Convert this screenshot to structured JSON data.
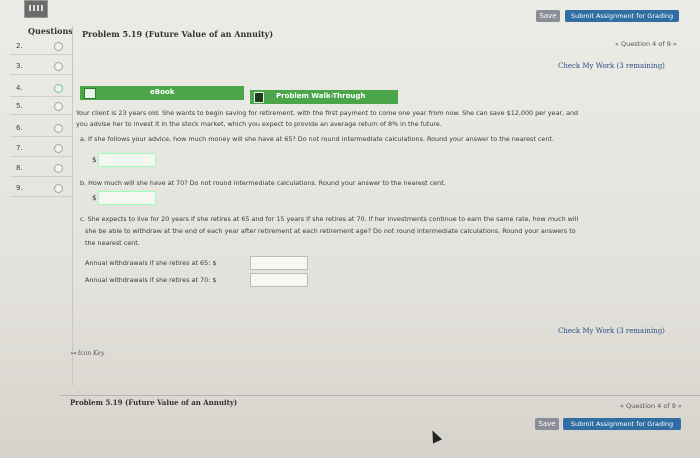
{
  "header": {
    "save_label": "Save",
    "submit_label": "Submit Assignment for Grading"
  },
  "sidebar": {
    "title": "Questions",
    "items": [
      {
        "num": "2."
      },
      {
        "num": "3."
      },
      {
        "num": "4."
      },
      {
        "num": "5."
      },
      {
        "num": "6."
      },
      {
        "num": "7."
      },
      {
        "num": "8."
      },
      {
        "num": "9."
      }
    ]
  },
  "problem": {
    "title": "Problem 5.19 (Future Value of an Annuity)",
    "question_nav": "« Question 4 of 9 »",
    "check_work": "Check My Work (3 remaining)"
  },
  "tabs": {
    "ebook": "eBook",
    "walkthrough": "Problem Walk-Through"
  },
  "question": {
    "intro_line1": "Your client is 23 years old. She wants to begin saving for retirement, with the first payment to come one year from now. She can save $12,000 per year, and",
    "intro_line2": "you advise her to invest it in the stock market, which you expect to provide an average return of 8% in the future.",
    "part_a": "a. If she follows your advice, how much money will she have at 65? Do not round intermediate calculations. Round your answer to the nearest cent.",
    "part_b": "b. How much will she have at 70? Do not round intermediate calculations. Round your answer to the nearest cent.",
    "part_c_line1": "c. She expects to live for 20 years if she retires at 65 and for 15 years if she retires at 70. If her investments continue to earn the same rate, how much will",
    "part_c_line2": "she be able to withdraw at the end of each year after retirement at each retirement age? Do not round intermediate calculations. Round your answers to",
    "part_c_line3": "the nearest cent.",
    "dollar": "$",
    "withdraw_65": "Annual withdrawals if she retires at 65: $",
    "withdraw_70": "Annual withdrawals if she retires at 70: $",
    "answer_a": "",
    "answer_b": "",
    "answer_65": "",
    "answer_70": ""
  },
  "footer": {
    "icon_key": "Icon Key",
    "check_work": "Check My Work (3 remaining)",
    "title": "Problem 5.19 (Future Value of an Annuity)",
    "question_nav": "« Question 4 of 9 »",
    "save_label": "Save",
    "submit_label": "Submit Assignment for Grading"
  }
}
